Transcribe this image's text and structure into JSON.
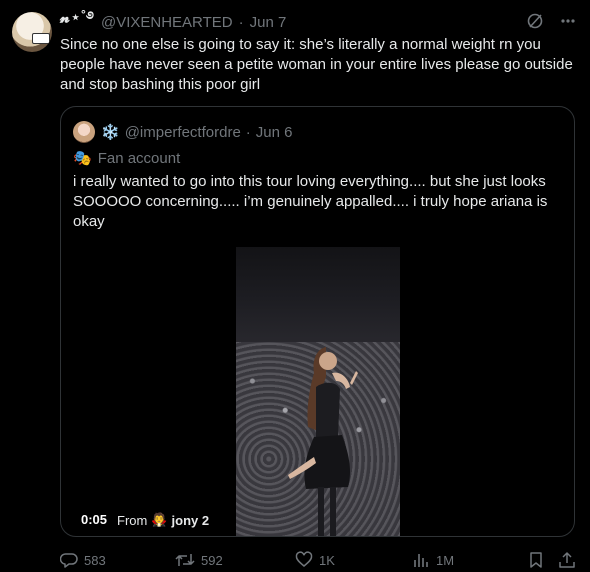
{
  "tweet": {
    "author_name": "𝓷⋆˚࿔",
    "handle": "@VIXENHEARTED",
    "separator": "·",
    "date": "Jun 7",
    "text": "Since no one else is going to say it: she’s literally a normal weight rn you people have never seen a petite woman in your entire lives please go outside and stop bashing this poor girl"
  },
  "quote": {
    "name_icon": "❄️",
    "handle": "@imperfectfordre",
    "separator": "·",
    "date": "Jun 6",
    "label_icon": "🎭",
    "label": "Fan account",
    "text": "i really wanted to go into this tour loving everything.... but she just looks SOOOOO concerning..... i’m genuinely appalled.... i truly hope ariana is okay",
    "video": {
      "time": "0:05",
      "from_label": "From",
      "from_icon": "🧛",
      "from_name": "jony 2"
    }
  },
  "actions": {
    "replies": "583",
    "retweets": "592",
    "likes": "1K",
    "views": "1M"
  },
  "colors": {
    "background": "#000000",
    "text": "#e7e9ea",
    "muted": "#71767b",
    "border": "#2f3336"
  },
  "icons": [
    "grok-icon",
    "more-icon",
    "reply-icon",
    "retweet-icon",
    "like-icon",
    "views-icon",
    "bookmark-icon",
    "share-icon"
  ]
}
